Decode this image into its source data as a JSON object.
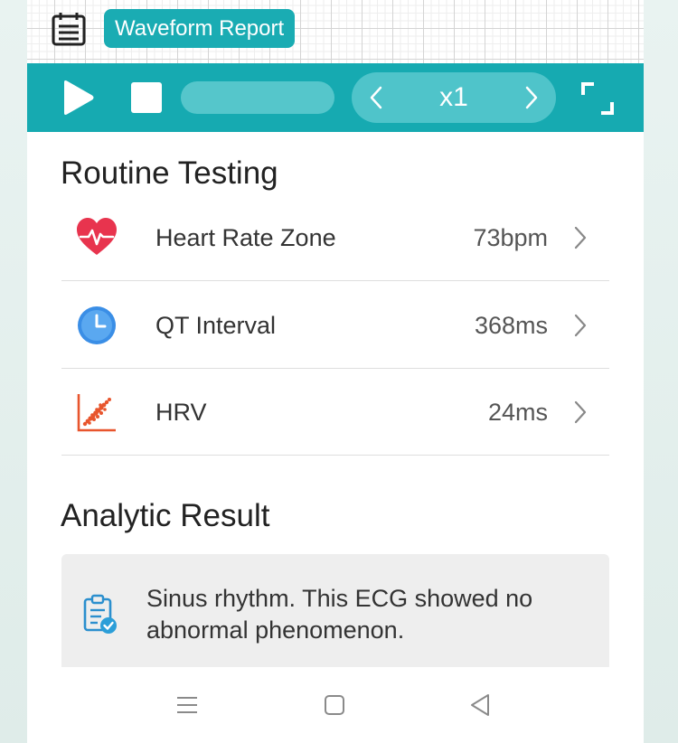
{
  "header": {
    "report_badge": "Waveform Report",
    "icon": "report-icon"
  },
  "toolbar": {
    "play_icon": "play-icon",
    "stop_icon": "stop-icon",
    "speed": "x1",
    "prev_icon": "chevron-left-icon",
    "next_icon": "chevron-right-icon",
    "fullscreen_icon": "fullscreen-icon"
  },
  "routine": {
    "title": "Routine Testing",
    "items": [
      {
        "label": "Heart Rate Zone",
        "value": "73bpm",
        "icon": "heart-pulse-icon"
      },
      {
        "label": "QT Interval",
        "value": "368ms",
        "icon": "clock-icon"
      },
      {
        "label": "HRV",
        "value": "24ms",
        "icon": "scatter-chart-icon"
      }
    ]
  },
  "analytic": {
    "title": "Analytic Result",
    "text": "Sinus rhythm. This ECG showed no abnormal phenomenon.",
    "icon": "clipboard-check-icon"
  },
  "colors": {
    "accent": "#16aab1",
    "heart": "#e8344e",
    "clock": "#3a8ee6",
    "hrv": "#e8552d"
  }
}
